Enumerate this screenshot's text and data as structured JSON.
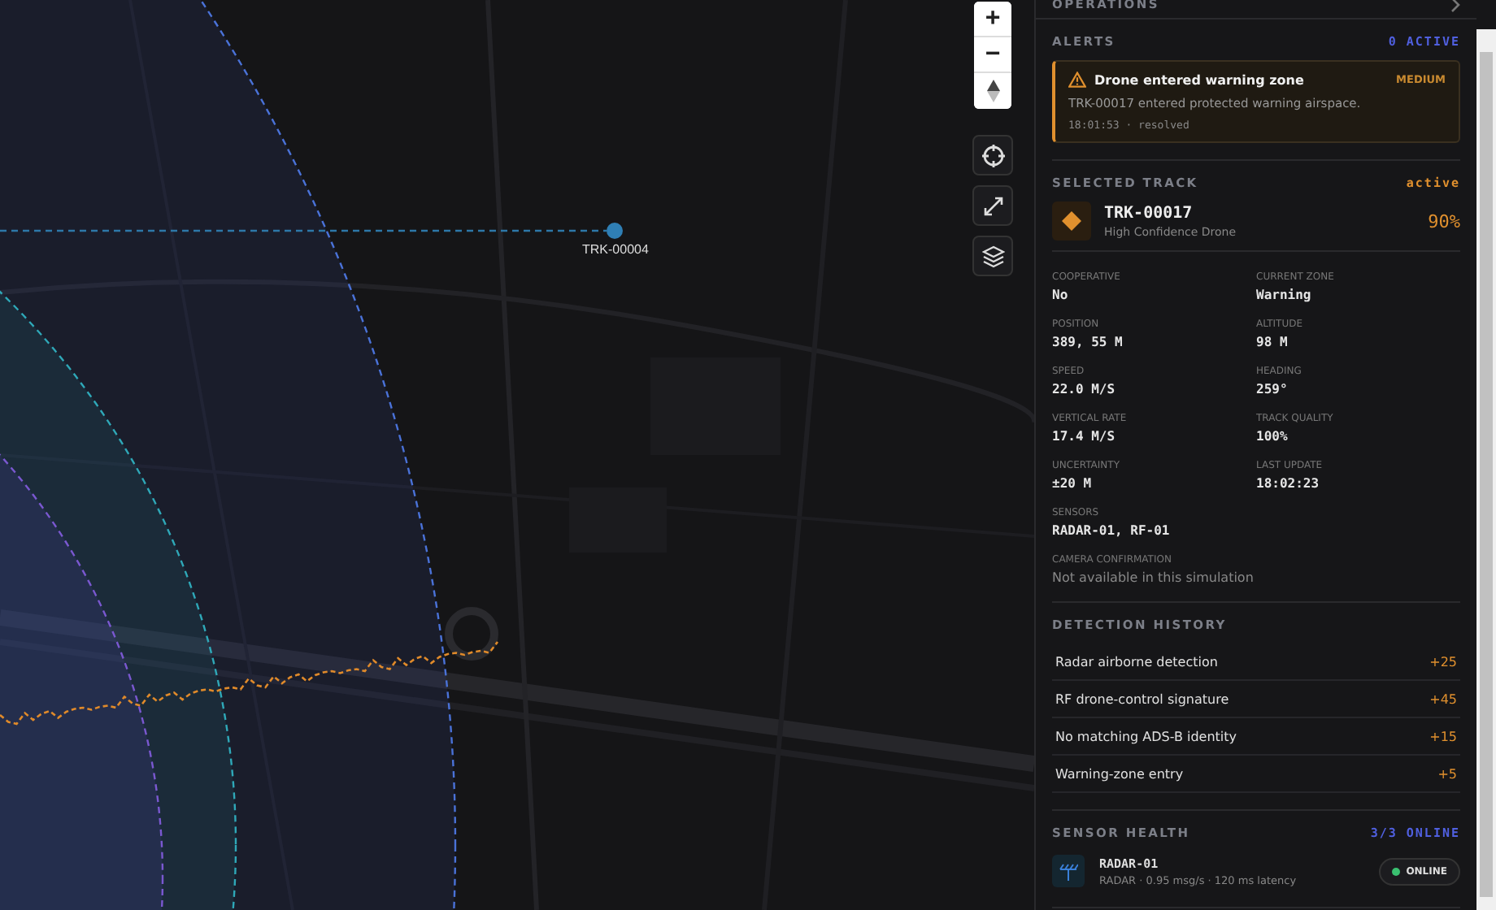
{
  "map": {
    "zoom_in": "+",
    "zoom_out": "−",
    "track_label": "TRK-00004"
  },
  "operations": {
    "title": "OPERATIONS"
  },
  "alerts": {
    "title": "ALERTS",
    "count": "0 ACTIVE",
    "items": [
      {
        "title": "Drone entered warning zone",
        "severity": "MEDIUM",
        "message": "TRK-00017 entered protected warning airspace.",
        "time": "18:01:53 · resolved"
      }
    ]
  },
  "selected_track": {
    "title": "SELECTED TRACK",
    "status": "active",
    "id": "TRK-00017",
    "classification": "High Confidence Drone",
    "confidence": "90%",
    "fields": [
      {
        "label": "COOPERATIVE",
        "value": "No",
        "kind": "mono"
      },
      {
        "label": "CURRENT ZONE",
        "value": "Warning",
        "kind": "mono"
      },
      {
        "label": "POSITION",
        "value": "389, 55 M",
        "kind": "mono"
      },
      {
        "label": "ALTITUDE",
        "value": "98 M",
        "kind": "mono"
      },
      {
        "label": "SPEED",
        "value": "22.0 M/S",
        "kind": "mono"
      },
      {
        "label": "HEADING",
        "value": "259°",
        "kind": "mono"
      },
      {
        "label": "VERTICAL RATE",
        "value": "17.4 M/S",
        "kind": "mono"
      },
      {
        "label": "TRACK QUALITY",
        "value": "100%",
        "kind": "mono"
      },
      {
        "label": "UNCERTAINTY",
        "value": "±20 M",
        "kind": "mono"
      },
      {
        "label": "LAST UPDATE",
        "value": "18:02:23",
        "kind": "mono"
      },
      {
        "label": "SENSORS",
        "value": "RADAR-01, RF-01",
        "kind": "wide"
      },
      {
        "label": "CAMERA CONFIRMATION",
        "value": "Not available in this simulation",
        "kind": "note"
      }
    ]
  },
  "detection_history": {
    "title": "DETECTION HISTORY",
    "items": [
      {
        "label": "Radar airborne detection",
        "score": "+25"
      },
      {
        "label": "RF drone-control signature",
        "score": "+45"
      },
      {
        "label": "No matching ADS-B identity",
        "score": "+15"
      },
      {
        "label": "Warning-zone entry",
        "score": "+5"
      }
    ]
  },
  "sensor_health": {
    "title": "SENSOR HEALTH",
    "summary": "3/3 ONLINE",
    "sensors": [
      {
        "name": "RADAR-01",
        "detail": "RADAR · 0.95 msg/s · 120 ms latency",
        "status": "ONLINE",
        "online": true
      }
    ]
  }
}
